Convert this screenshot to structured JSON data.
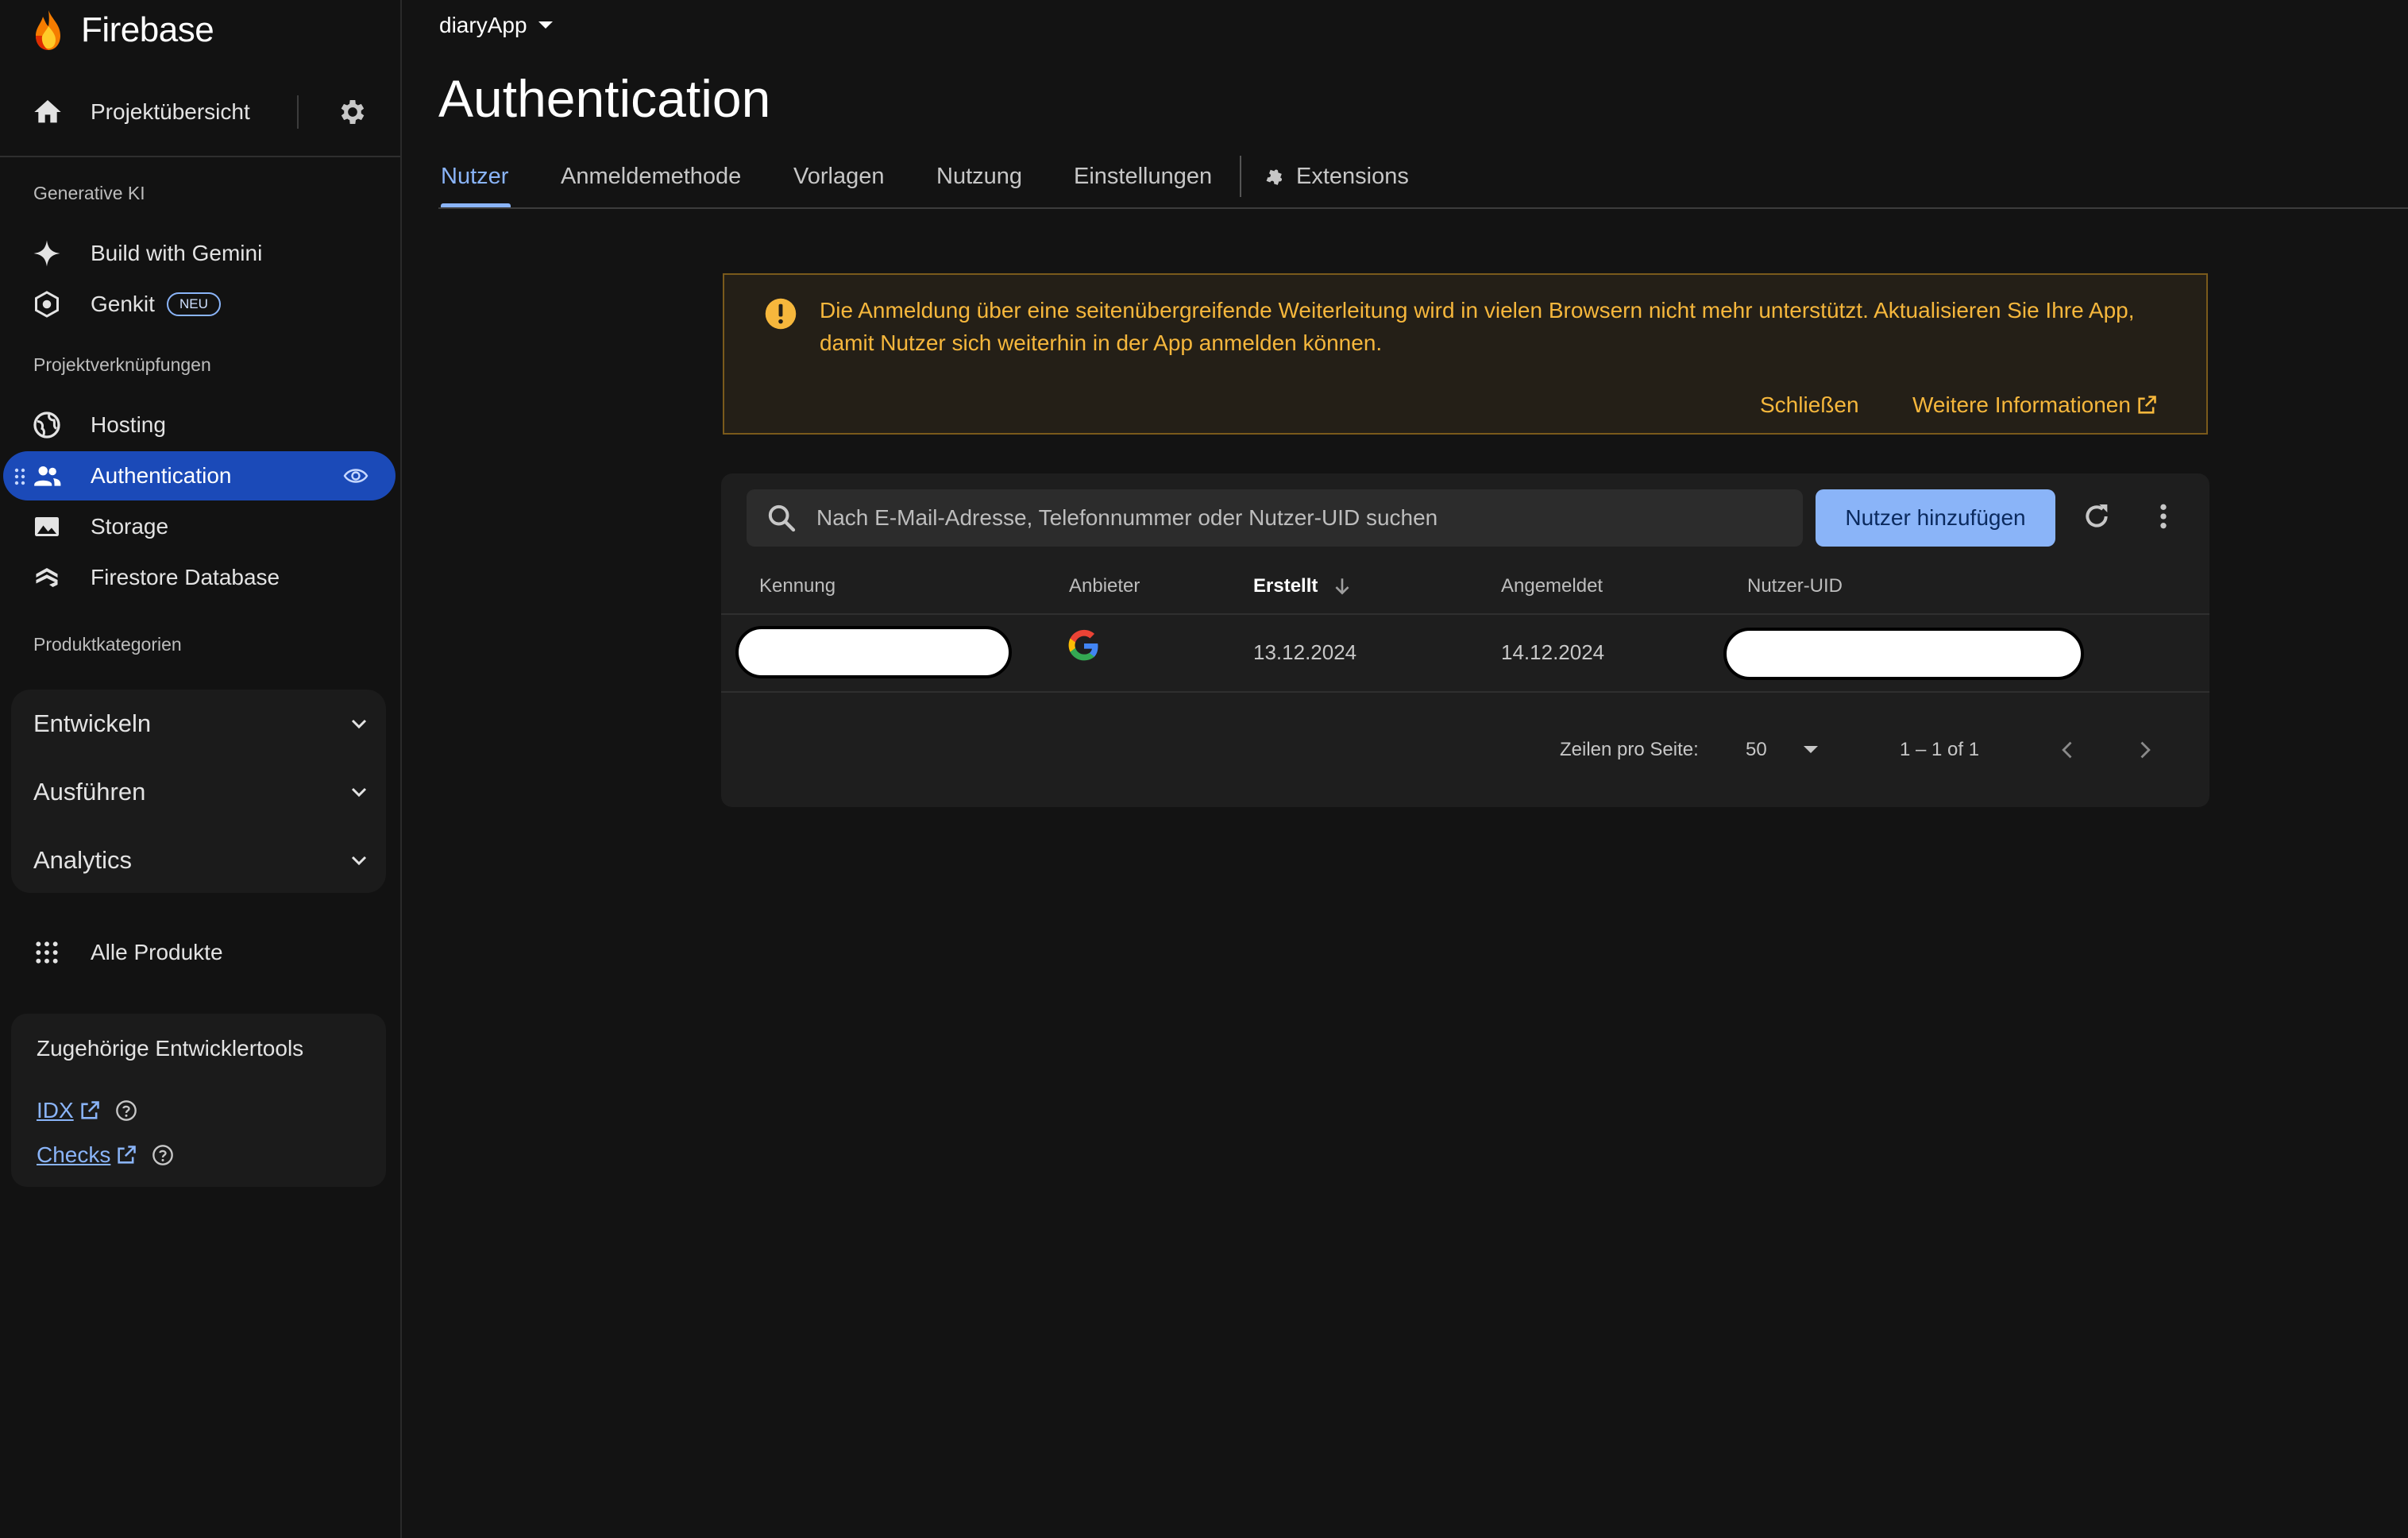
{
  "app": {
    "brand": "Firebase",
    "project": "diaryApp"
  },
  "sidebar": {
    "overview": "Projektübersicht",
    "sections": {
      "generative": "Generative KI",
      "links": "Projektverknüpfungen",
      "categories": "Produktkategorien"
    },
    "gen_items": [
      {
        "label": "Build with Gemini",
        "icon": "sparkle-icon"
      },
      {
        "label": "Genkit",
        "badge": "NEU",
        "icon": "genkit-icon"
      }
    ],
    "link_items": [
      {
        "label": "Hosting",
        "icon": "globe-icon"
      },
      {
        "label": "Authentication",
        "icon": "users-icon",
        "active": true
      },
      {
        "label": "Storage",
        "icon": "image-icon"
      },
      {
        "label": "Firestore Database",
        "icon": "firestore-icon"
      }
    ],
    "categories": [
      "Entwickeln",
      "Ausführen",
      "Analytics"
    ],
    "all_products": "Alle Produkte",
    "tools": {
      "title": "Zugehörige Entwicklertools",
      "links": [
        "IDX",
        "Checks"
      ]
    }
  },
  "main": {
    "title": "Authentication",
    "tabs": [
      "Nutzer",
      "Anmeldemethode",
      "Vorlagen",
      "Nutzung",
      "Einstellungen",
      "Extensions"
    ],
    "active_tab": "Nutzer",
    "banner": {
      "message": "Die Anmeldung über eine seitenübergreifende Weiterleitung wird in vielen Browsern nicht mehr unterstützt. Aktualisieren Sie Ihre App, damit Nutzer sich weiterhin in der App anmelden können.",
      "close": "Schließen",
      "more": "Weitere Informationen"
    },
    "users": {
      "search_placeholder": "Nach E-Mail-Adresse, Telefonnummer oder Nutzer-UID suchen",
      "add_button": "Nutzer hinzufügen",
      "columns": [
        "Kennung",
        "Anbieter",
        "Erstellt",
        "Angemeldet",
        "Nutzer-UID"
      ],
      "sorted_column": "Erstellt",
      "rows": [
        {
          "identifier": "",
          "provider": "google",
          "created": "13.12.2024",
          "signed_in": "14.12.2024",
          "uid": ""
        }
      ],
      "pagination": {
        "rows_label": "Zeilen pro Seite:",
        "rows_value": "50",
        "range": "1 – 1 of 1"
      }
    }
  },
  "colors": {
    "accent": "#8ab4f8",
    "active_nav": "#1b4ab8",
    "warning": "#f6b73c",
    "background": "#131313"
  }
}
